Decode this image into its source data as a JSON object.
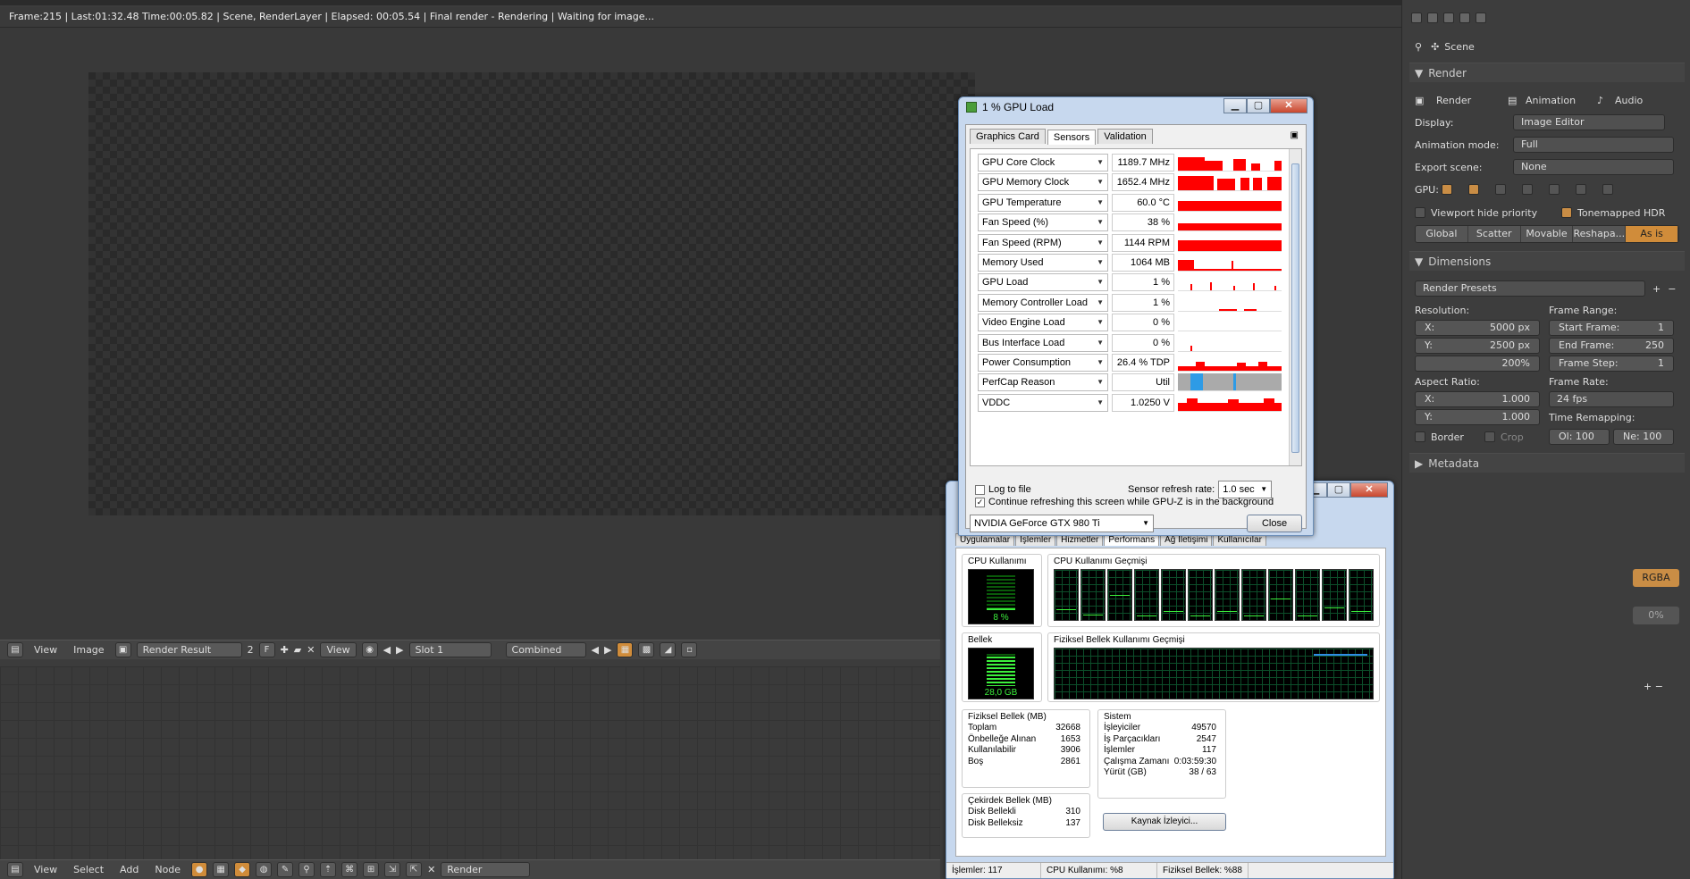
{
  "blender": {
    "status_text": "Frame:215 | Last:01:32.48 Time:00:05.82 | Scene, RenderLayer | Elapsed: 00:05.54 | Final render - Rendering | Waiting for image...",
    "image_header": {
      "view": "View",
      "image": "Image",
      "image_name": "Render Result",
      "users": "2",
      "fake": "F",
      "view2": "View",
      "slot": "Slot 1",
      "pass": "Combined"
    },
    "node_header": {
      "view": "View",
      "select": "Select",
      "add": "Add",
      "node": "Node",
      "render_layer": "Render"
    }
  },
  "properties": {
    "breadcrumb": "Scene",
    "render_panel": {
      "title": "Render",
      "render_btn": "Render",
      "animation_btn": "Animation",
      "audio_btn": "Audio",
      "display_label": "Display:",
      "display_value": "Image Editor",
      "animation_mode_label": "Animation mode:",
      "animation_mode_value": "Full",
      "export_scene_label": "Export scene:",
      "export_scene_value": "None",
      "gpu_label": "GPU:",
      "viewport_hide": "Viewport hide priority",
      "tonemapped": "Tonemapped HDR",
      "modes": [
        "Global",
        "Scatter",
        "Movable",
        "Reshapa...",
        "As is"
      ]
    },
    "dimensions_panel": {
      "title": "Dimensions",
      "presets": "Render Presets",
      "resolution_label": "Resolution:",
      "res_x_label": "X:",
      "res_x": "5000 px",
      "res_y_label": "Y:",
      "res_y": "2500 px",
      "res_pct": "200%",
      "aspect_label": "Aspect Ratio:",
      "asp_x_label": "X:",
      "asp_x": "1.000",
      "asp_y_label": "Y:",
      "asp_y": "1.000",
      "border": "Border",
      "crop": "Crop",
      "frame_range_label": "Frame Range:",
      "start_label": "Start Frame:",
      "start": "1",
      "end_label": "End Frame:",
      "end": "250",
      "step_label": "Frame Step:",
      "step": "1",
      "frame_rate_label": "Frame Rate:",
      "frame_rate": "24 fps",
      "time_remap_label": "Time Remapping:",
      "old": "Ol: 100",
      "new": "Ne: 100"
    },
    "metadata_title": "Metadata",
    "rgba": "RGBA",
    "zero_pct": "0%"
  },
  "gpuz": {
    "title": "1 % GPU Load",
    "tabs": [
      "Graphics Card",
      "Sensors",
      "Validation"
    ],
    "sensors": [
      {
        "name": "GPU Core Clock",
        "value": "1189.7 MHz"
      },
      {
        "name": "GPU Memory Clock",
        "value": "1652.4 MHz"
      },
      {
        "name": "GPU Temperature",
        "value": "60.0 °C"
      },
      {
        "name": "Fan Speed (%)",
        "value": "38 %"
      },
      {
        "name": "Fan Speed (RPM)",
        "value": "1144 RPM"
      },
      {
        "name": "Memory Used",
        "value": "1064 MB"
      },
      {
        "name": "GPU Load",
        "value": "1 %"
      },
      {
        "name": "Memory Controller Load",
        "value": "1 %"
      },
      {
        "name": "Video Engine Load",
        "value": "0 %"
      },
      {
        "name": "Bus Interface Load",
        "value": "0 %"
      },
      {
        "name": "Power Consumption",
        "value": "26.4 % TDP"
      },
      {
        "name": "PerfCap Reason",
        "value": "Util"
      },
      {
        "name": "VDDC",
        "value": "1.0250 V"
      }
    ],
    "log_to_file": "Log to file",
    "refresh_label": "Sensor refresh rate:",
    "refresh_value": "1.0 sec",
    "continue_refresh": "Continue refreshing this screen while GPU-Z is in the background",
    "card": "NVIDIA GeForce GTX 980 Ti",
    "close": "Close"
  },
  "taskmgr": {
    "tabs": [
      "Uygulamalar",
      "İşlemler",
      "Hizmetler",
      "Performans",
      "Ağ İletişimi",
      "Kullanıcılar"
    ],
    "cpu_usage_title": "CPU Kullanımı",
    "cpu_usage": "8 %",
    "cpu_usage_fraction": 0.08,
    "cpu_history_title": "CPU Kullanımı Geçmişi",
    "memory_title": "Bellek",
    "memory": "28,0 GB",
    "memory_fraction": 0.88,
    "mem_history_title": "Fiziksel Bellek Kullanımı Geçmişi",
    "physical_title": "Fiziksel Bellek (MB)",
    "physical": [
      {
        "k": "Toplam",
        "v": "32668"
      },
      {
        "k": "Önbelleğe Alınan",
        "v": "1653"
      },
      {
        "k": "Kullanılabilir",
        "v": "3906"
      },
      {
        "k": "Boş",
        "v": "2861"
      }
    ],
    "kernel_title": "Çekirdek Bellek (MB)",
    "kernel": [
      {
        "k": "Disk Bellekli",
        "v": "310"
      },
      {
        "k": "Disk Belleksiz",
        "v": "137"
      }
    ],
    "system_title": "Sistem",
    "system": [
      {
        "k": "İşleyiciler",
        "v": "49570"
      },
      {
        "k": "İş Parçacıkları",
        "v": "2547"
      },
      {
        "k": "İşlemler",
        "v": "117"
      },
      {
        "k": "Çalışma Zamanı",
        "v": "0:03:59:30"
      },
      {
        "k": "Yürüt (GB)",
        "v": "38 / 63"
      }
    ],
    "resource_monitor": "Kaynak İzleyici...",
    "status": {
      "processes": "İşlemler: 117",
      "cpu": "CPU Kullanımı: %8",
      "memory": "Fiziksel Bellek: %88"
    }
  },
  "colors": {
    "blender_accent": "#d08c3a",
    "gpuz_graph": "#ff0000",
    "taskmgr_green": "#3cf03c"
  }
}
